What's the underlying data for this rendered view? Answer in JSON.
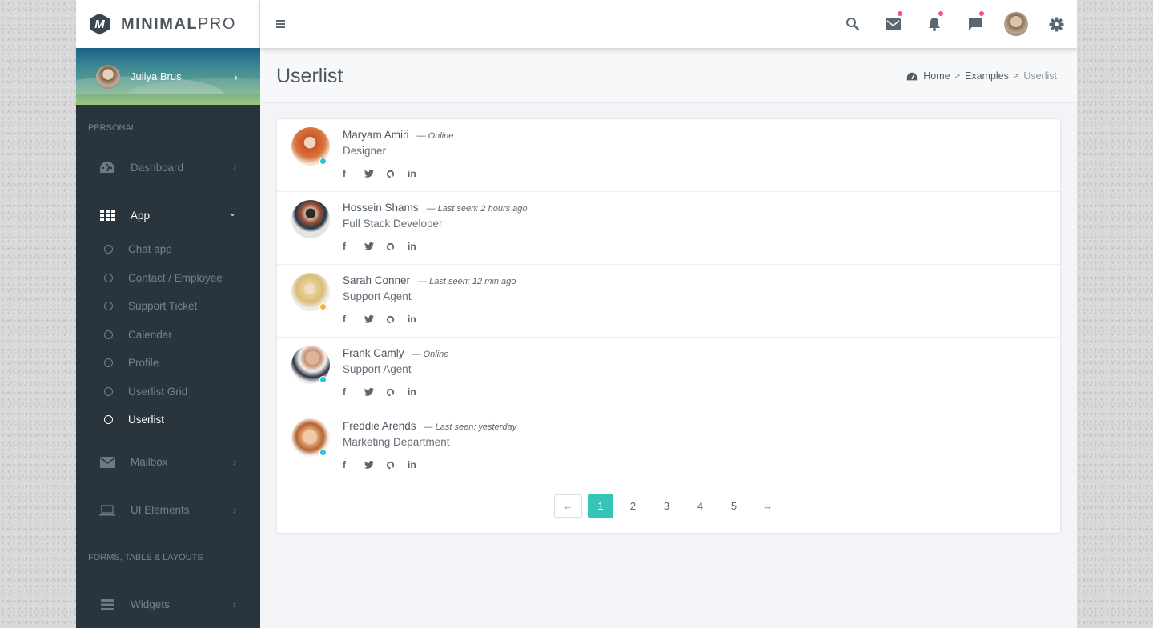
{
  "brand": {
    "logo_letter": "M",
    "name_bold": "MINIMAL",
    "name_light": "PRO"
  },
  "topbar": {
    "icons": [
      {
        "name": "search-icon",
        "badge": false
      },
      {
        "name": "mail-icon",
        "badge": true
      },
      {
        "name": "bell-icon",
        "badge": true
      },
      {
        "name": "chat-icon",
        "badge": true
      },
      {
        "name": "user-avatar",
        "badge": false
      },
      {
        "name": "gear-icon",
        "badge": false
      }
    ],
    "badge_color": "#ff4f70"
  },
  "sidebar": {
    "user": {
      "name": "Juliya Brus",
      "chevron": "›"
    },
    "sections": [
      {
        "header": "PERSONAL",
        "items": [
          {
            "label": "Dashboard",
            "icon": "dashboard-icon",
            "chevron": "›",
            "active": false
          },
          {
            "label": "App",
            "icon": "grid-icon",
            "chevron": "⌄",
            "active": true,
            "submenu": [
              {
                "label": "Chat app",
                "active": false
              },
              {
                "label": "Contact / Employee",
                "active": false
              },
              {
                "label": "Support Ticket",
                "active": false
              },
              {
                "label": "Calendar",
                "active": false
              },
              {
                "label": "Profile",
                "active": false
              },
              {
                "label": "Userlist Grid",
                "active": false
              },
              {
                "label": "Userlist",
                "active": true
              }
            ]
          },
          {
            "label": "Mailbox",
            "icon": "envelope-icon",
            "chevron": "›",
            "active": false
          },
          {
            "label": "UI Elements",
            "icon": "laptop-icon",
            "chevron": "›",
            "active": false
          }
        ]
      },
      {
        "header": "FORMS, TABLE & LAYOUTS",
        "items": [
          {
            "label": "Widgets",
            "icon": "bars-icon",
            "chevron": "›",
            "active": false
          }
        ]
      }
    ]
  },
  "page": {
    "title": "Userlist",
    "breadcrumb": [
      {
        "label": "Home",
        "icon": "dashboard-icon"
      },
      {
        "label": "Examples"
      },
      {
        "label": "Userlist",
        "current": true
      }
    ],
    "breadcrumb_separator": ">"
  },
  "users": [
    {
      "name": "Maryam Amiri",
      "status": "— Online",
      "role": "Designer",
      "presence": "online",
      "presence_color": "#26c6da"
    },
    {
      "name": "Hossein Shams",
      "status": "— Last seen: 2 hours ago",
      "role": "Full Stack Developer",
      "presence": "none",
      "presence_color": ""
    },
    {
      "name": "Sarah Conner",
      "status": "— Last seen: 12 min ago",
      "role": "Support Agent",
      "presence": "away",
      "presence_color": "#ffb22b"
    },
    {
      "name": "Frank Camly",
      "status": "— Online",
      "role": "Support Agent",
      "presence": "online",
      "presence_color": "#26c6da"
    },
    {
      "name": "Freddie Arends",
      "status": "— Last seen: yesterday",
      "role": "Marketing Department",
      "presence": "online",
      "presence_color": "#26c6da"
    }
  ],
  "socials": [
    {
      "name": "facebook-icon",
      "glyph": "f"
    },
    {
      "name": "twitter-icon",
      "glyph": "🐦"
    },
    {
      "name": "github-icon",
      "glyph": "○"
    },
    {
      "name": "linkedin-icon",
      "glyph": "in"
    }
  ],
  "pagination": {
    "prev": "←",
    "pages": [
      "1",
      "2",
      "3",
      "4",
      "5"
    ],
    "current": "1",
    "next": "→",
    "active_color": "#33c6b5"
  }
}
